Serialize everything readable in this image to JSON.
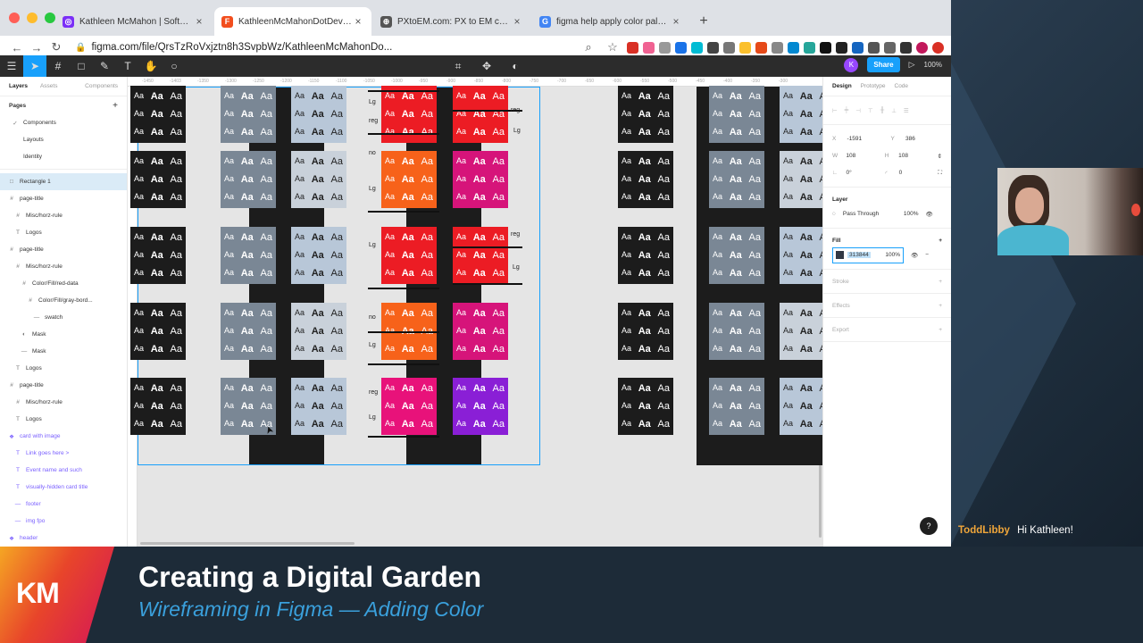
{
  "browser": {
    "tabs": [
      {
        "title": "Kathleen McMahon | Software",
        "fav_color": "#7b2ff7",
        "fav_glyph": "◎",
        "active": false
      },
      {
        "title": "KathleenMcMahonDotDev – Figma",
        "fav_color": "#f24e1e",
        "fav_glyph": "F",
        "active": true
      },
      {
        "title": "PXtoEM.com: PX to EM conversion",
        "fav_color": "#555555",
        "fav_glyph": "⊕",
        "active": false
      },
      {
        "title": "figma help apply color palette",
        "fav_color": "#4285f4",
        "fav_glyph": "G",
        "active": false
      }
    ],
    "new_tab": "+",
    "url": "figma.com/file/QrsTzRoVxjztn8h3SvpbWz/KathleenMcMahonDo...",
    "nav": {
      "back": "←",
      "forward": "→",
      "reload": "↻"
    }
  },
  "figma": {
    "zoom": "100%",
    "share": "Share",
    "avatar": "K",
    "left_tabs": {
      "layers": "Layers",
      "assets": "Assets",
      "components": "Components"
    },
    "pages_label": "Pages",
    "pages": [
      {
        "label": "Components",
        "current": true
      },
      {
        "label": "Layouts",
        "current": false
      },
      {
        "label": "Identity",
        "current": false
      }
    ],
    "layers": [
      {
        "label": "Rectangle 1",
        "icon": "□",
        "indent": 0,
        "selected": true,
        "comp": false
      },
      {
        "label": "page-title",
        "icon": "#",
        "indent": 0,
        "selected": false,
        "comp": false
      },
      {
        "label": "Misc/horz-rule",
        "icon": "#",
        "indent": 1,
        "selected": false,
        "comp": false
      },
      {
        "label": "Logos",
        "icon": "T",
        "indent": 1,
        "selected": false,
        "comp": false
      },
      {
        "label": "page-title",
        "icon": "#",
        "indent": 0,
        "selected": false,
        "comp": false
      },
      {
        "label": "Misc/horz-rule",
        "icon": "#",
        "indent": 1,
        "selected": false,
        "comp": false
      },
      {
        "label": "Color/Fill/red-data",
        "icon": "#",
        "indent": 2,
        "selected": false,
        "comp": false
      },
      {
        "label": "Color/Fill/gray-bord...",
        "icon": "#",
        "indent": 3,
        "selected": false,
        "comp": false
      },
      {
        "label": "swatch",
        "icon": "—",
        "indent": 4,
        "selected": false,
        "comp": false
      },
      {
        "label": "Mask",
        "icon": "◐",
        "indent": 2,
        "selected": false,
        "comp": false
      },
      {
        "label": "Mask",
        "icon": "—",
        "indent": 2,
        "selected": false,
        "comp": false
      },
      {
        "label": "Logos",
        "icon": "T",
        "indent": 1,
        "selected": false,
        "comp": false
      },
      {
        "label": "page-title",
        "icon": "#",
        "indent": 0,
        "selected": false,
        "comp": false
      },
      {
        "label": "Misc/horz-rule",
        "icon": "#",
        "indent": 1,
        "selected": false,
        "comp": false
      },
      {
        "label": "Logos",
        "icon": "T",
        "indent": 1,
        "selected": false,
        "comp": false
      },
      {
        "label": "card with image",
        "icon": "❖",
        "indent": 0,
        "selected": false,
        "comp": true
      },
      {
        "label": "Link goes here >",
        "icon": "T",
        "indent": 1,
        "selected": false,
        "comp": true
      },
      {
        "label": "Event name and such",
        "icon": "T",
        "indent": 1,
        "selected": false,
        "comp": true
      },
      {
        "label": "visually-hidden card title",
        "icon": "T",
        "indent": 1,
        "selected": false,
        "comp": true
      },
      {
        "label": "footer",
        "icon": "—",
        "indent": 1,
        "selected": false,
        "comp": true
      },
      {
        "label": "img fpo",
        "icon": "—",
        "indent": 1,
        "selected": false,
        "comp": true
      },
      {
        "label": "header",
        "icon": "❖",
        "indent": 0,
        "selected": false,
        "comp": true
      }
    ],
    "ruler_ticks": [
      "-1450",
      "-1403",
      "-1350",
      "-1300",
      "-1250",
      "-1200",
      "-1150",
      "-1100",
      "-1050",
      "-1000",
      "-950",
      "-900",
      "-850",
      "-800",
      "-750",
      "-700",
      "-650",
      "-600",
      "-550",
      "-500",
      "-450",
      "-400",
      "-350",
      "-300"
    ],
    "canvas_labels": [
      "Lg",
      "reg",
      "reg",
      "Lg",
      "no",
      "Lg",
      "Lg",
      "reg",
      "Lg",
      "no",
      "Lg",
      "reg",
      "Lg"
    ],
    "swatch_text": {
      "a": "Aa"
    },
    "swatch_colors": {
      "black": "#1c1c1c",
      "slate": "#7a8795",
      "lightblue": "#b8c7d8",
      "palegray": "#c9d1da",
      "red": "#ec1c24",
      "orange": "#f7621a",
      "magenta": "#d6147a",
      "pink": "#e8127a",
      "purple": "#8a1fd6"
    },
    "right_tabs": {
      "design": "Design",
      "prototype": "Prototype",
      "code": "Code"
    },
    "props": {
      "x_label": "X",
      "x": "-1591",
      "y_label": "Y",
      "y": "386",
      "w_label": "W",
      "w": "108",
      "h_label": "H",
      "h": "108",
      "rot": "0°",
      "radius": "0"
    },
    "layer_section": {
      "title": "Layer",
      "blend": "Pass Through",
      "opacity": "100%"
    },
    "fill_section": {
      "title": "Fill",
      "hex": "313844",
      "opacity": "100%",
      "color": "#313844"
    },
    "stroke": "Stroke",
    "effects": "Effects",
    "export": "Export",
    "help": "?"
  },
  "chat": {
    "user": "ToddLibby",
    "message": "Hi Kathleen!"
  },
  "overlay": {
    "logo": "KM",
    "title": "Creating a Digital Garden",
    "subtitle": "Wireframing in Figma — Adding Color"
  }
}
